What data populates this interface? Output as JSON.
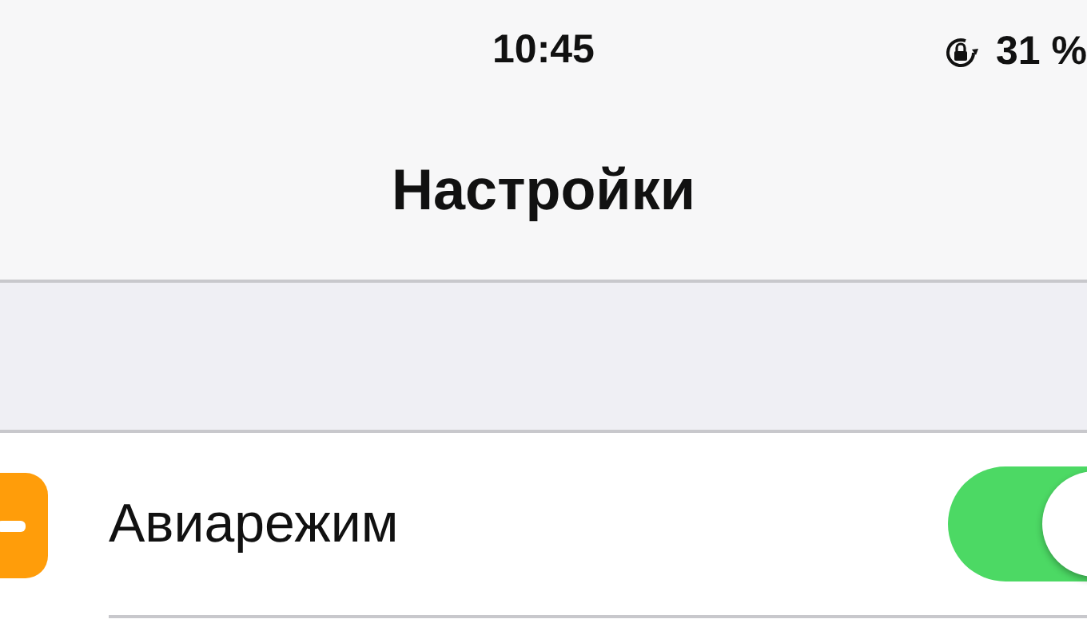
{
  "status_bar": {
    "time": "10:45",
    "battery": "31 %"
  },
  "nav_bar": {
    "title": "Настройки"
  },
  "rows": [
    {
      "label": "Авиарежим",
      "kind": "toggle",
      "on": true
    }
  ]
}
